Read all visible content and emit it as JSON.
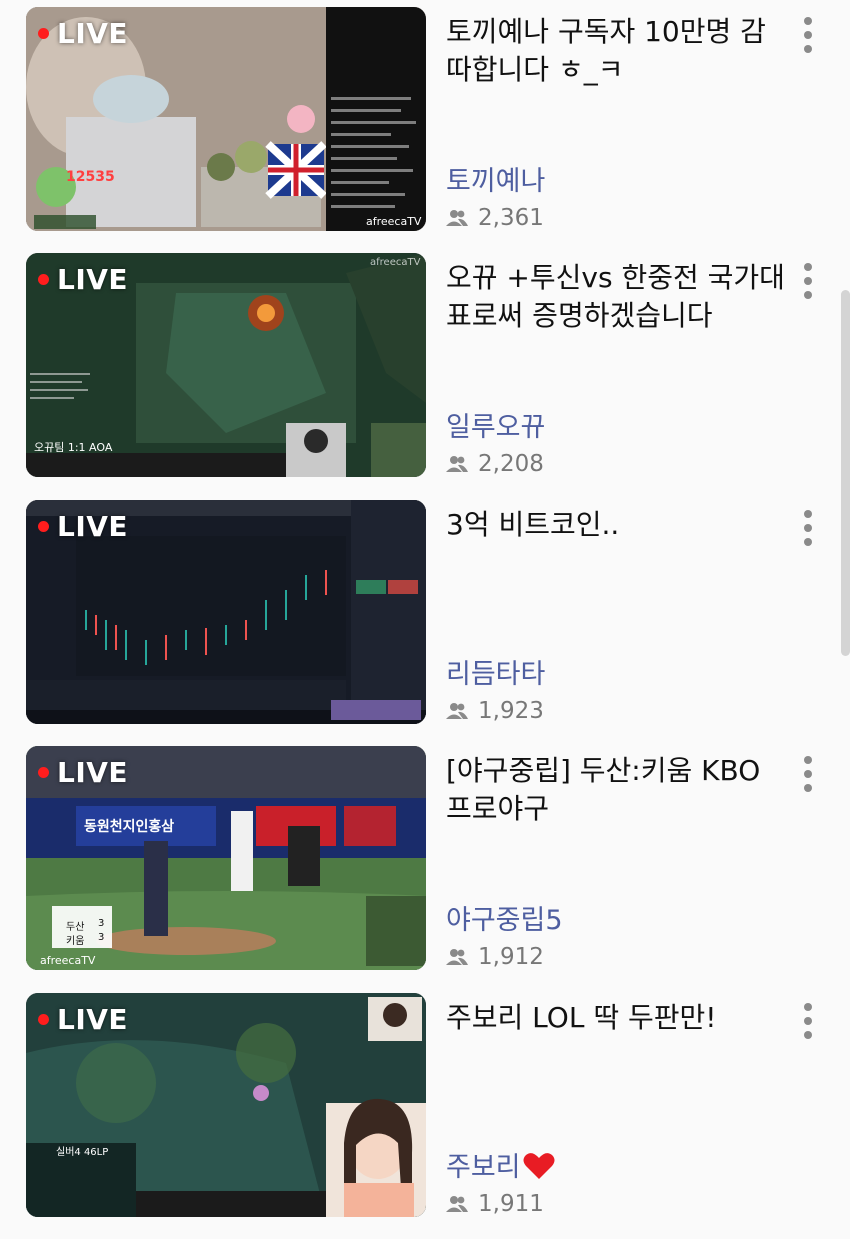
{
  "live_label": "LIVE",
  "colors": {
    "live_dot": "#ff1d1d",
    "channel": "#4e5ea0",
    "heart": "#e81c24"
  },
  "streams": [
    {
      "title": "토끼예나 구독자 10만명 감따합니다 ㅎ_ㅋ",
      "channel": "토끼예나",
      "viewers": "2,361",
      "thumb_text": {
        "count": "12535",
        "watermark": "afreecaTV"
      }
    },
    {
      "title": "오뀨 +투신vs 한중전 국가대표로써 증명하겠습니다",
      "channel": "일루오뀨",
      "viewers": "2,208",
      "thumb_text": {
        "score": "오뀨팀 1:1 AOA",
        "watermark": "afreecaTV"
      }
    },
    {
      "title": "3억 비트코인..",
      "channel": "리듬타타",
      "viewers": "1,923",
      "thumb_text": {}
    },
    {
      "title": "[야구중립] 두산:키움 KBO 프로야구",
      "channel": "야구중립5",
      "viewers": "1,912",
      "thumb_text": {
        "banner": "동원천지인홍삼",
        "team1": "두산",
        "team2": "키움",
        "score1": "3",
        "score2": "3",
        "watermark": "afreecaTV"
      }
    },
    {
      "title": "주보리 LOL 딱 두판만!",
      "channel": "주보리",
      "channel_suffix_icon": "heart-icon",
      "viewers": "1,911",
      "thumb_text": {
        "rank": "실버4 46LP"
      }
    }
  ]
}
